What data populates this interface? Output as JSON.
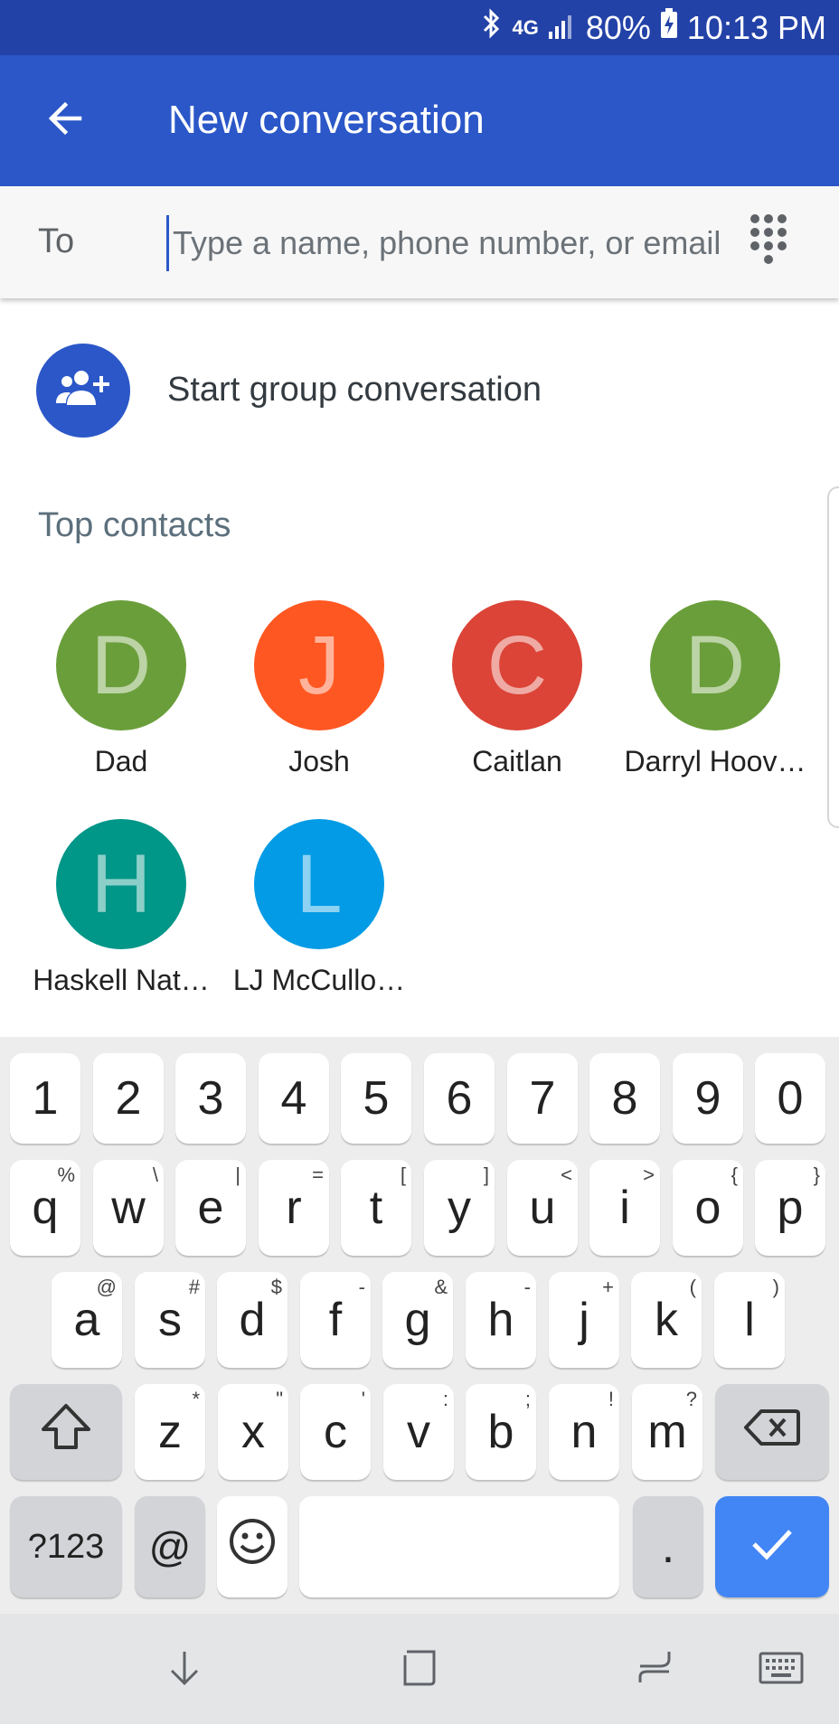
{
  "status_bar": {
    "network": "4G",
    "battery": "80%",
    "time": "10:13 PM"
  },
  "app_bar": {
    "title": "New conversation"
  },
  "to_row": {
    "label": "To",
    "placeholder": "Type a name, phone number, or email"
  },
  "group": {
    "label": "Start group conversation"
  },
  "top_contacts": {
    "title": "Top contacts",
    "contacts": [
      {
        "initial": "D",
        "name": "Dad",
        "color": "#6a9e3a"
      },
      {
        "initial": "J",
        "name": "Josh",
        "color": "#ff5722"
      },
      {
        "initial": "C",
        "name": "Caitlan",
        "color": "#db4437"
      },
      {
        "initial": "D",
        "name": "Darryl Hoov…",
        "color": "#6a9e3a"
      },
      {
        "initial": "H",
        "name": "Haskell Nat…",
        "color": "#009688"
      },
      {
        "initial": "L",
        "name": "LJ McCullo…",
        "color": "#039be5"
      }
    ]
  },
  "keyboard": {
    "number_row": [
      "1",
      "2",
      "3",
      "4",
      "5",
      "6",
      "7",
      "8",
      "9",
      "0"
    ],
    "row1": [
      {
        "key": "q",
        "hint": "%"
      },
      {
        "key": "w",
        "hint": "\\"
      },
      {
        "key": "e",
        "hint": "|"
      },
      {
        "key": "r",
        "hint": "="
      },
      {
        "key": "t",
        "hint": "["
      },
      {
        "key": "y",
        "hint": "]"
      },
      {
        "key": "u",
        "hint": "<"
      },
      {
        "key": "i",
        "hint": ">"
      },
      {
        "key": "o",
        "hint": "{"
      },
      {
        "key": "p",
        "hint": "}"
      }
    ],
    "row2": [
      {
        "key": "a",
        "hint": "@"
      },
      {
        "key": "s",
        "hint": "#"
      },
      {
        "key": "d",
        "hint": "$"
      },
      {
        "key": "f",
        "hint": "-"
      },
      {
        "key": "g",
        "hint": "&"
      },
      {
        "key": "h",
        "hint": "-"
      },
      {
        "key": "j",
        "hint": "+"
      },
      {
        "key": "k",
        "hint": "("
      },
      {
        "key": "l",
        "hint": ")"
      }
    ],
    "row3": [
      {
        "key": "z",
        "hint": "*"
      },
      {
        "key": "x",
        "hint": "\""
      },
      {
        "key": "c",
        "hint": "'"
      },
      {
        "key": "v",
        "hint": ":"
      },
      {
        "key": "b",
        "hint": ";"
      },
      {
        "key": "n",
        "hint": "!"
      },
      {
        "key": "m",
        "hint": "?"
      }
    ],
    "symbols_label": "?123",
    "at_label": "@",
    "period_label": "."
  },
  "icons": {
    "back": "arrow-back-icon",
    "dialpad": "dialpad-icon",
    "group": "group-add-icon",
    "shift": "shift-icon",
    "backspace": "backspace-icon",
    "emoji": "emoji-icon",
    "enter": "check-icon",
    "nav_down": "nav-down-icon",
    "nav_home": "nav-home-icon",
    "nav_recents": "nav-recents-icon",
    "nav_keyboard": "keyboard-icon"
  },
  "colors": {
    "status_bar": "#2342a8",
    "app_bar": "#2b57c8",
    "accent": "#4285f4"
  }
}
